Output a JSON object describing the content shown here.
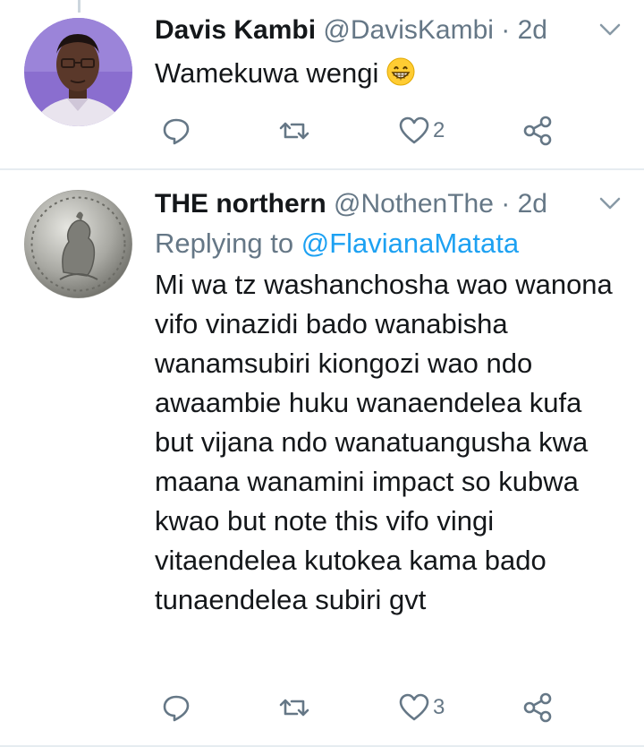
{
  "tweets": [
    {
      "name": "Davis Kambi",
      "handle": "@DavisKambi",
      "separator": "·",
      "time": "2d",
      "text": "Wamekuwa wengi",
      "emoji": "grinning-face-emoji",
      "reply_count": "",
      "retweet_count": "",
      "like_count": "2"
    },
    {
      "name": "THE northern",
      "handle": "@NothenThe",
      "separator": "·",
      "time": "2d",
      "replying_prefix": "Replying to",
      "replying_to": "@FlavianaMatata",
      "text": "Mi wa  tz washanchosha wao wanona vifo vinazidi bado wanabisha wanamsubiri kiongozi wao ndo awaambie huku wanaendelea kufa but vijana ndo wanatuangusha kwa maana wanamini impact so kubwa kwao but note this vifo  vingi  vitaendelea kutokea kama bado tunaendelea subiri gvt",
      "reply_count": "",
      "retweet_count": "",
      "like_count": "3"
    }
  ],
  "icons": {
    "reply": "reply-icon",
    "retweet": "retweet-icon",
    "like": "heart-icon",
    "share": "share-icon",
    "menu": "chevron-down-icon"
  },
  "colors": {
    "text": "#14171a",
    "muted": "#657786",
    "link": "#1da1f2",
    "divider": "#e6ecf0"
  }
}
